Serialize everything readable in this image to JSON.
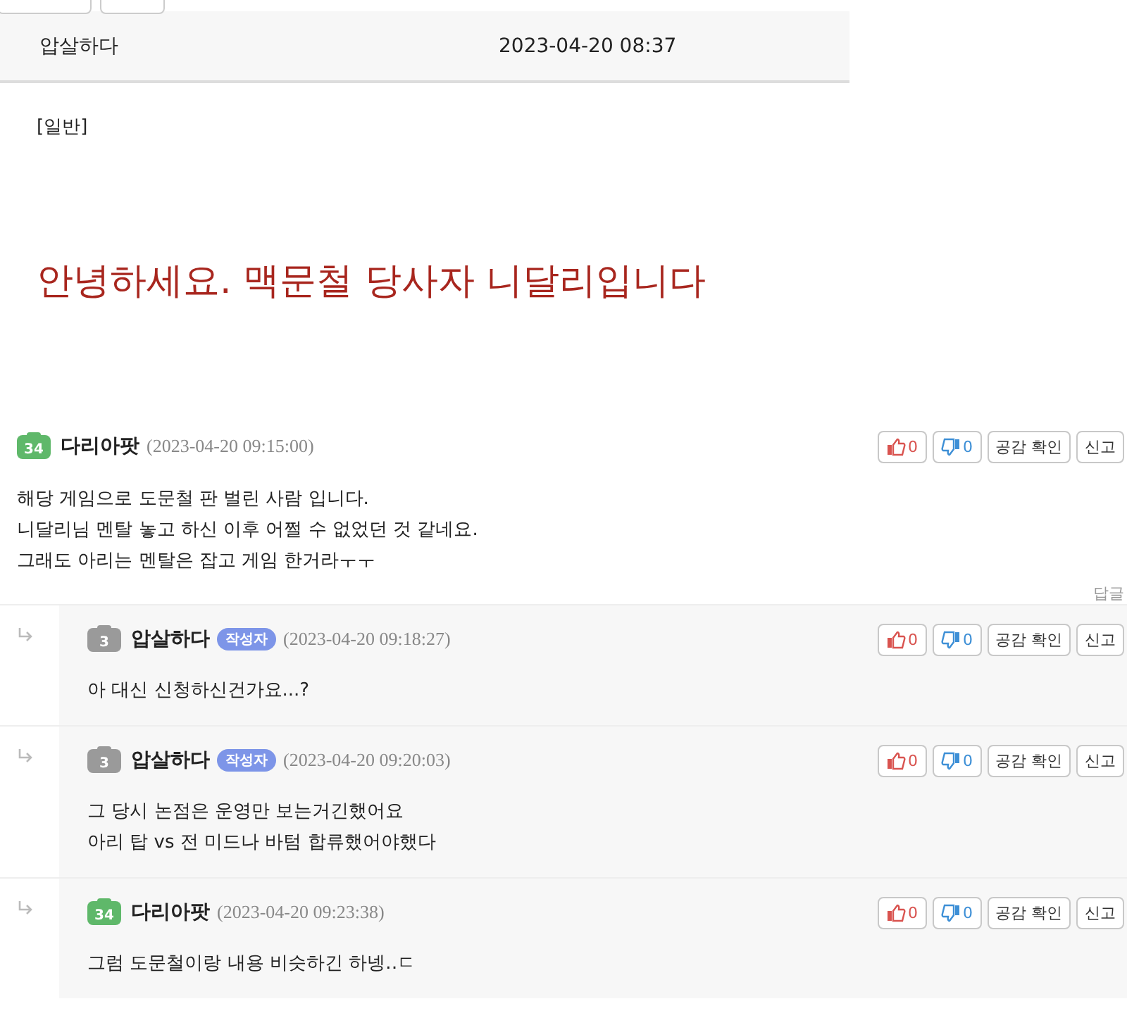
{
  "top_buttons": [
    {
      "kind": "wide"
    },
    {
      "kind": "narrow"
    }
  ],
  "post": {
    "author": "압살하다",
    "date": "2023-04-20 08:37",
    "category": "[일반]",
    "title": "안녕하세요. 맥문철 당사자 니달리입니다"
  },
  "comments": [
    {
      "reply": false,
      "author": "다리아팟",
      "user_level": "34",
      "color": "#5fb86a",
      "time": "(2023-04-20 09:15:00)",
      "lines": [
        "해당 게임으로 도문철 판 벌린 사람 입니다.",
        "니달리님 멘탈 놓고 하신 이후 어쩔 수 없었던 것 같네요.",
        "그래도 아리는 멘탈은 잡고 게임 한거라ㅜㅜ"
      ],
      "likes": "0",
      "dislikes": "0",
      "empathy": "공감 확인",
      "report": "신고",
      "reply_link": "답글"
    },
    {
      "reply": true,
      "author": "압살하다",
      "user_level": "3",
      "color": "#9a9a9a",
      "writer_tag": "작성자",
      "time": "(2023-04-20 09:18:27)",
      "lines": [
        "아 대신 신청하신건가요...?"
      ],
      "likes": "0",
      "dislikes": "0",
      "empathy": "공감 확인",
      "report": "신고"
    },
    {
      "reply": true,
      "author": "압살하다",
      "user_level": "3",
      "color": "#9a9a9a",
      "writer_tag": "작성자",
      "time": "(2023-04-20 09:20:03)",
      "lines": [
        "그 당시 논점은 운영만 보는거긴했어요",
        "아리 탑 vs 전 미드나 바텀 합류했어야했다"
      ],
      "likes": "0",
      "dislikes": "0",
      "empathy": "공감 확인",
      "report": "신고"
    },
    {
      "reply": true,
      "author": "다리아팟",
      "user_level": "34",
      "color": "#5fb86a",
      "time": "(2023-04-20 09:23:38)",
      "lines": [
        "그럼 도문철이랑 내용 비슷하긴 하넹‥ㄷ"
      ],
      "likes": "0",
      "dislikes": "0",
      "empathy": "공감 확인",
      "report": "신고"
    }
  ]
}
